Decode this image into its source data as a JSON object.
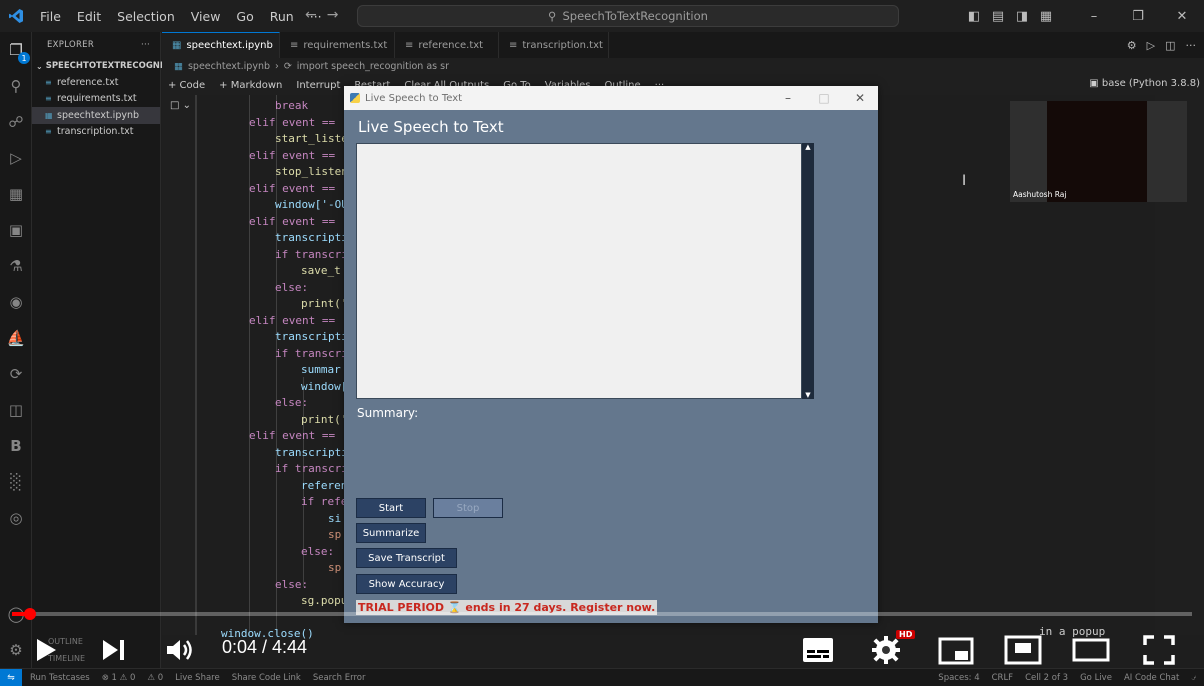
{
  "titlebar": {
    "menu": [
      "File",
      "Edit",
      "Selection",
      "View",
      "Go",
      "Run",
      "···"
    ],
    "search": "SpeechToTextRecognition"
  },
  "activity": {
    "badge": "1"
  },
  "sidebar": {
    "header": "EXPLORER",
    "folder": "SPEECHTOTEXTRECOGNITI...",
    "files": [
      "reference.txt",
      "requirements.txt",
      "speechtext.ipynb",
      "transcription.txt"
    ]
  },
  "tabs": [
    "speechtext.ipynb",
    "requirements.txt",
    "reference.txt",
    "transcription.txt"
  ],
  "breadcrumb": {
    "file": "speechtext.ipynb",
    "symbol": "import speech_recognition as sr"
  },
  "nbtoolbar": {
    "items": [
      "+ Code",
      "+ Markdown",
      "Interrupt",
      "Restart",
      "Clear All Outputs",
      "Go To",
      "Variables",
      "Outline",
      "···"
    ],
    "kernel": "base (Python 3.8.8)"
  },
  "code": {
    "break": "break",
    "elif_event": "elif event == '",
    "start_listen": "start_liste",
    "stop_listen": "stop_listen",
    "window_out": "window['-OU",
    "transcript": "transcripti",
    "if_transcr": "if transcri",
    "save_t": "save_t",
    "else": "else:",
    "print": "print('",
    "summary": "summar",
    "window": "window[",
    "reference": "referen",
    "if_ref": "if refe",
    "si": "si",
    "sp": "sp",
    "popup_call": "sg.popu",
    "window_close": "window.close()",
    "popup_comment": "in a popup"
  },
  "participant": {
    "name": "Aashutosh Raj"
  },
  "popup": {
    "window_title": "Live Speech to Text",
    "app_title": "Live Speech to Text",
    "summary_label": "Summary:",
    "buttons": {
      "start": "Start",
      "stop": "Stop",
      "summarize": "Summarize",
      "save": "Save Transcript",
      "accuracy": "Show Accuracy"
    },
    "trial": "TRIAL PERIOD ⌛ ends in 27 days. Register now."
  },
  "player": {
    "time": "0:04 / 4:44",
    "progress_fraction": 0.015,
    "hd": "HD",
    "underlay_outline": "OUTLINE",
    "underlay_timeline": "TIMELINE"
  },
  "statusbar": {
    "left": [
      "Run Testcases",
      "⊗ 1 ⚠ 0",
      "⚠ 0",
      "Live Share",
      "Share Code Link",
      "Search Error"
    ],
    "right": [
      "Spaces: 4",
      "CRLF",
      "Cell 2 of 3",
      "Go Live",
      "AI Code Chat"
    ]
  }
}
